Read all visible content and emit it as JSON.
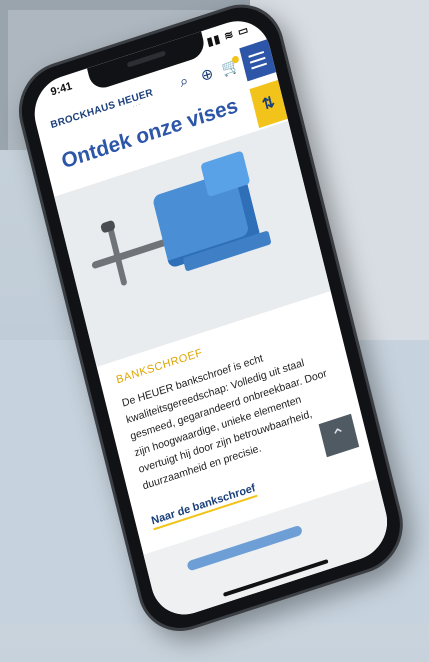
{
  "status_bar": {
    "time": "9:41",
    "icons": "▮▮ ≋ ▭"
  },
  "header": {
    "logo": "BROCKHAUS HEUER",
    "logo_sub": "· · ·",
    "search_icon": "⌕",
    "globe_icon": "⊕",
    "cart_icon": "🛒"
  },
  "page_title": "Ontdek onze vises",
  "filter_label": "⇅",
  "product": {
    "category": "BANKSCHROEF",
    "description": "De HEUER bankschroef is echt kwaliteitsgereedschap: Volledig uit staal gesmeed, gegarandeerd onbreekbaar. Door zijn hoogwaardige, unieke elementen overtuigt hij door zijn betrouwbaarheid, duurzaamheid en precisie.",
    "link": "Naar de bankschroef"
  },
  "scroll_top_label": "⌃",
  "colors": {
    "brand_blue": "#1b3f7a",
    "accent_yellow": "#f2c31a",
    "vise_blue": "#4a8fd6"
  }
}
